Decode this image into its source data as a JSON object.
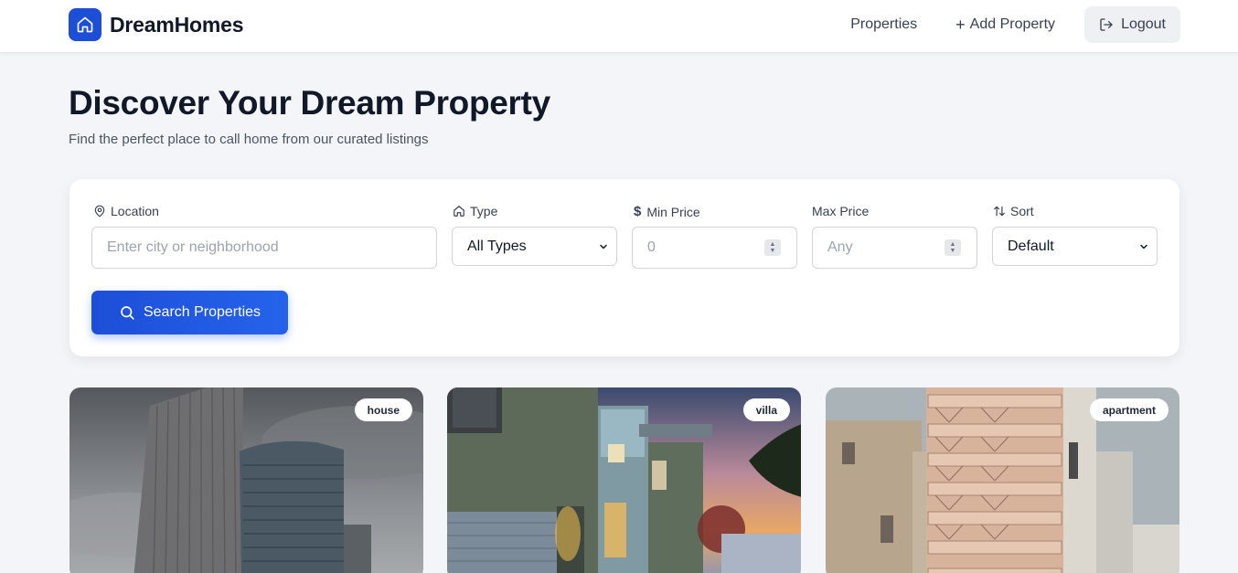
{
  "brand": {
    "name": "DreamHomes",
    "logo_icon": "home-icon",
    "accent": "#1d4ed8"
  },
  "nav": {
    "properties": "Properties",
    "add_property": "Add Property",
    "logout": "Logout"
  },
  "hero": {
    "title": "Discover Your Dream Property",
    "subtitle": "Find the perfect place to call home from our curated listings"
  },
  "filters": {
    "location": {
      "label": "Location",
      "placeholder": "Enter city or neighborhood",
      "icon": "map-pin-icon"
    },
    "type": {
      "label": "Type",
      "selected": "All Types",
      "icon": "home-icon"
    },
    "min_price": {
      "label": "Min Price",
      "placeholder": "0",
      "icon": "dollar-icon"
    },
    "max_price": {
      "label": "Max Price",
      "placeholder": "Any"
    },
    "sort": {
      "label": "Sort",
      "selected": "Default",
      "icon": "sort-arrows-icon"
    },
    "search_button": "Search Properties"
  },
  "listings": [
    {
      "type": "house"
    },
    {
      "type": "villa"
    },
    {
      "type": "apartment"
    }
  ]
}
